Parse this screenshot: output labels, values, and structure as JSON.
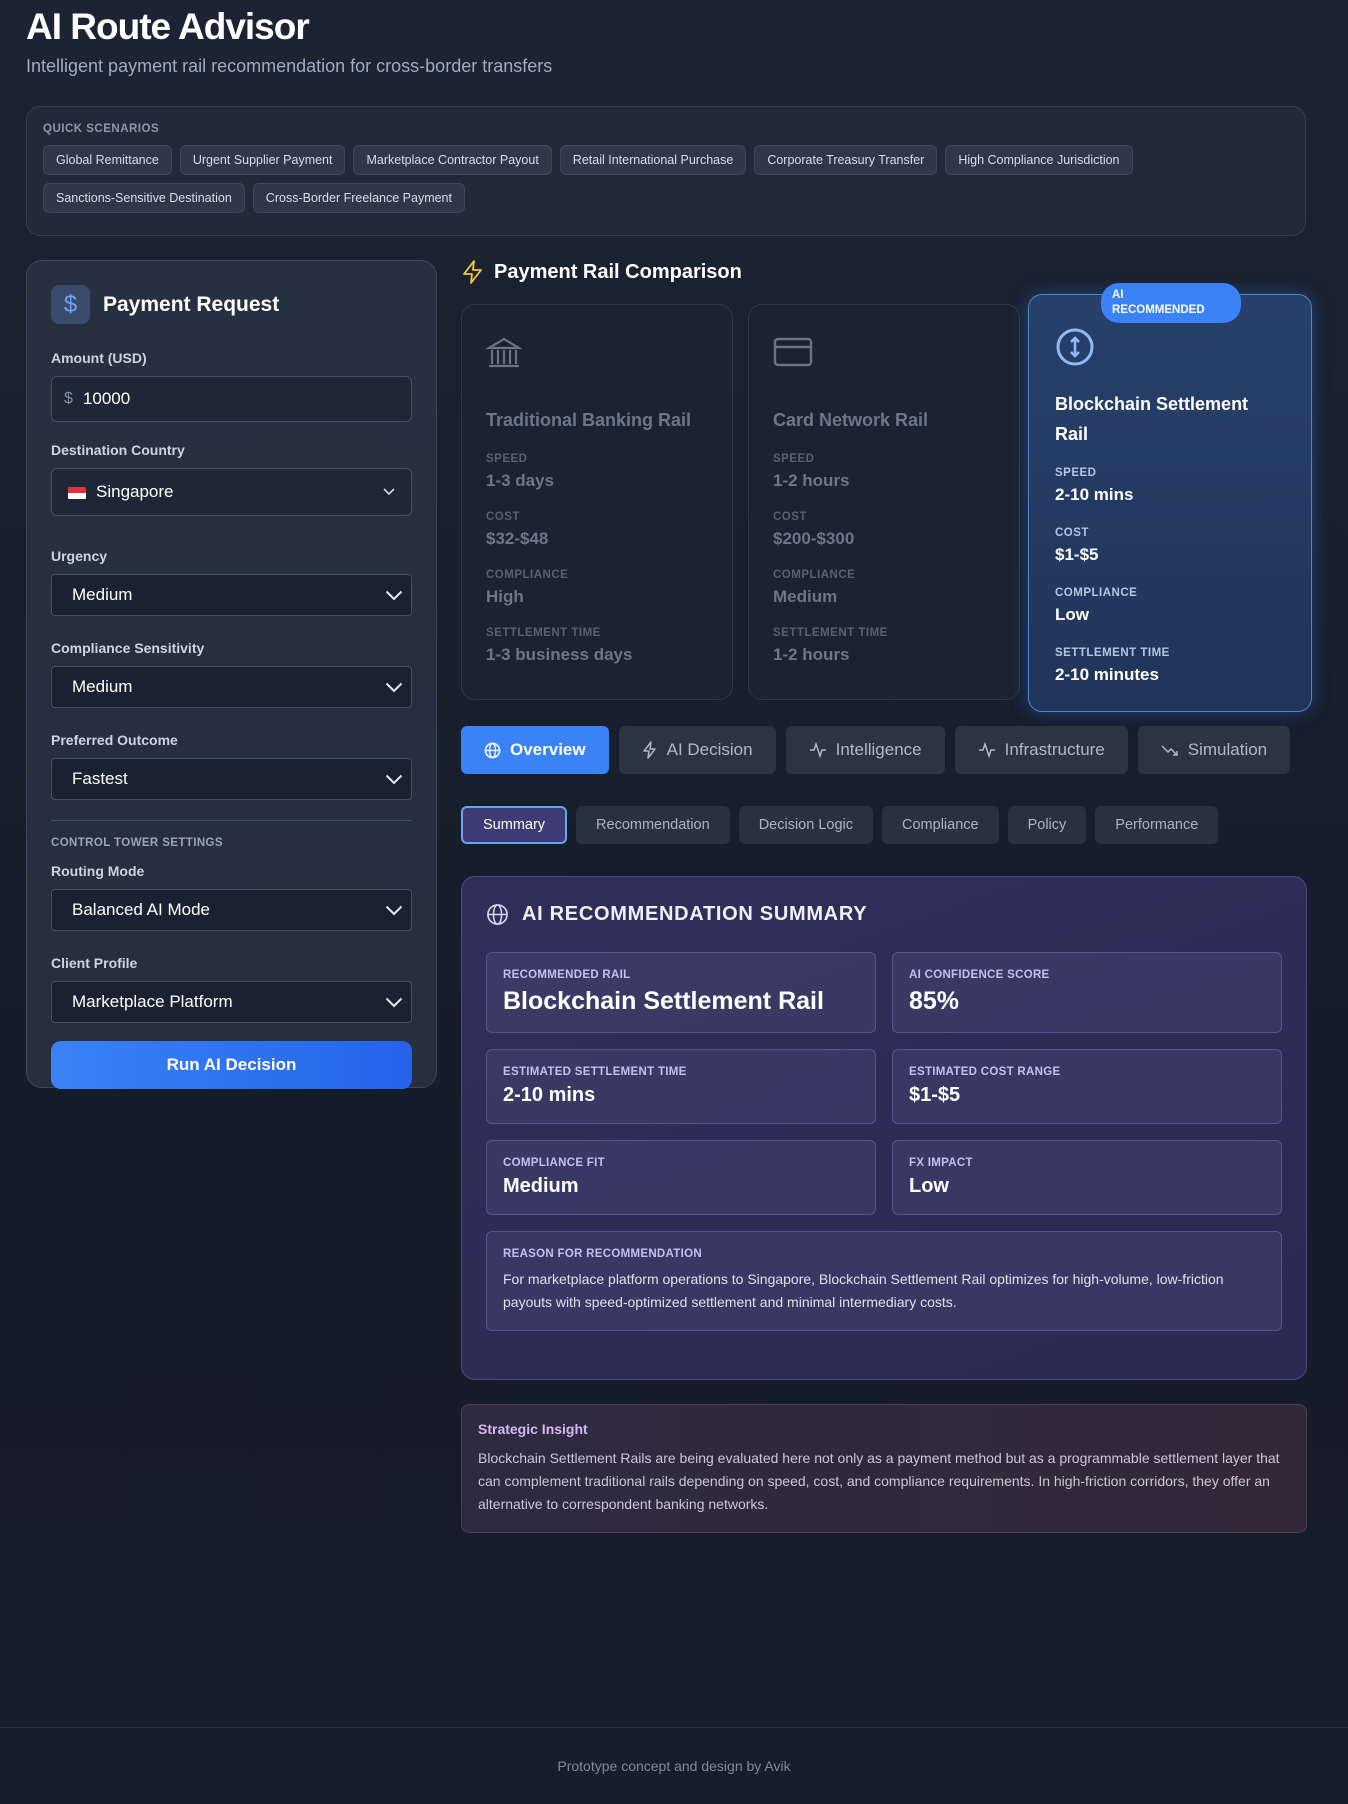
{
  "header": {
    "title": "AI Route Advisor",
    "subtitle": "Intelligent payment rail recommendation for cross-border transfers"
  },
  "quick_scenarios": {
    "title": "QUICK SCENARIOS",
    "items": [
      "Global Remittance",
      "Urgent Supplier Payment",
      "Marketplace Contractor Payout",
      "Retail International Purchase",
      "Corporate Treasury Transfer",
      "High Compliance Jurisdiction",
      "Sanctions-Sensitive Destination",
      "Cross-Border Freelance Payment"
    ]
  },
  "payment_request": {
    "title": "Payment Request",
    "amount_label": "Amount (USD)",
    "amount_prefix": "$",
    "amount_value": "10000",
    "destination_label": "Destination Country",
    "destination_value": "Singapore",
    "urgency_label": "Urgency",
    "urgency_value": "Medium",
    "compliance_label": "Compliance Sensitivity",
    "compliance_value": "Medium",
    "outcome_label": "Preferred Outcome",
    "outcome_value": "Fastest",
    "control_tower_title": "CONTROL TOWER SETTINGS",
    "routing_label": "Routing Mode",
    "routing_value": "Balanced AI Mode",
    "client_label": "Client Profile",
    "client_value": "Marketplace Platform",
    "run_button": "Run AI Decision"
  },
  "comparison": {
    "title": "Payment Rail Comparison",
    "rails": [
      {
        "name": "Traditional Banking Rail",
        "icon": "bank-icon",
        "speed_label": "SPEED",
        "speed": "1-3 days",
        "cost_label": "COST",
        "cost": "$32-$48",
        "compliance_label": "COMPLIANCE",
        "compliance": "High",
        "settlement_label": "SETTLEMENT TIME",
        "settlement": "1-3 business days"
      },
      {
        "name": "Card Network Rail",
        "icon": "credit-card-icon",
        "speed_label": "SPEED",
        "speed": "1-2 hours",
        "cost_label": "COST",
        "cost": "$200-$300",
        "compliance_label": "COMPLIANCE",
        "compliance": "Medium",
        "settlement_label": "SETTLEMENT TIME",
        "settlement": "1-2 hours"
      },
      {
        "name": "Blockchain Settlement Rail",
        "icon": "bitcoin-icon",
        "badge": "AI RECOMMENDED",
        "speed_label": "SPEED",
        "speed": "2-10 mins",
        "cost_label": "COST",
        "cost": "$1-$5",
        "compliance_label": "COMPLIANCE",
        "compliance": "Low",
        "settlement_label": "SETTLEMENT TIME",
        "settlement": "2-10 minutes"
      }
    ]
  },
  "tabs": [
    "Overview",
    "AI Decision",
    "Intelligence",
    "Infrastructure",
    "Simulation"
  ],
  "subtabs": [
    "Summary",
    "Recommendation",
    "Decision Logic",
    "Compliance",
    "Policy",
    "Performance"
  ],
  "summary": {
    "title": "AI RECOMMENDATION SUMMARY",
    "recommended_rail_label": "RECOMMENDED RAIL",
    "recommended_rail": "Blockchain Settlement Rail",
    "confidence_label": "AI CONFIDENCE SCORE",
    "confidence": "85%",
    "settlement_label": "ESTIMATED SETTLEMENT TIME",
    "settlement": "2-10 mins",
    "cost_label": "ESTIMATED COST RANGE",
    "cost": "$1-$5",
    "compliance_label": "COMPLIANCE FIT",
    "compliance": "Medium",
    "fx_label": "FX IMPACT",
    "fx": "Low",
    "reason_label": "REASON FOR RECOMMENDATION",
    "reason": "For marketplace platform operations to Singapore, Blockchain Settlement Rail optimizes for high-volume, low-friction payouts with speed-optimized settlement and minimal intermediary costs."
  },
  "insight": {
    "title": "Strategic Insight",
    "text": "Blockchain Settlement Rails are being evaluated here not only as a payment method but as a programmable settlement layer that can complement traditional rails depending on speed, cost, and compliance requirements. In high-friction corridors, they offer an alternative to correspondent banking networks."
  },
  "footer": "Prototype concept and design by Avik"
}
